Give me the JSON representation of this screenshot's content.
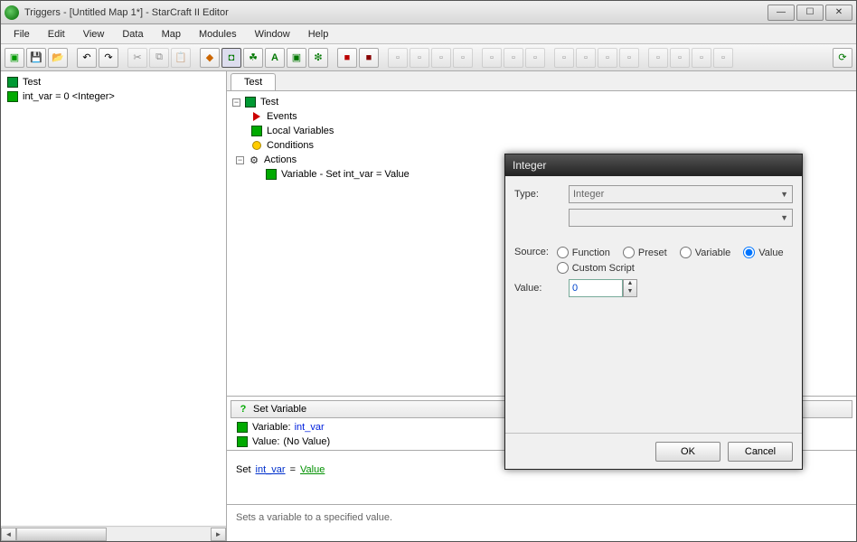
{
  "window": {
    "title": "Triggers - [Untitled Map 1*] - StarCraft II Editor"
  },
  "menus": [
    "File",
    "Edit",
    "View",
    "Data",
    "Map",
    "Modules",
    "Window",
    "Help"
  ],
  "left_tree": {
    "items": [
      {
        "label": "Test"
      },
      {
        "label": "int_var = 0 <Integer>"
      }
    ]
  },
  "tab": {
    "label": "Test"
  },
  "trigger_tree": {
    "root": "Test",
    "events": "Events",
    "localvars": "Local Variables",
    "conditions": "Conditions",
    "actions": "Actions",
    "action1": "Variable - Set int_var = Value"
  },
  "setvar": {
    "header": "Set Variable",
    "line1_label": "Variable:",
    "line1_value": "int_var",
    "line2_label": "Value:",
    "line2_value": "(No Value)"
  },
  "expr": {
    "set": "Set",
    "var": "int_var",
    "eq": "=",
    "val": "Value"
  },
  "hint": "Sets a variable to a specified value.",
  "dialog": {
    "title": "Integer",
    "type_label": "Type:",
    "type_value": "Integer",
    "source_label": "Source:",
    "radios": {
      "function": "Function",
      "preset": "Preset",
      "variable": "Variable",
      "value": "Value",
      "custom": "Custom Script"
    },
    "selected_source": "value",
    "value_label": "Value:",
    "value": "0",
    "ok": "OK",
    "cancel": "Cancel"
  }
}
